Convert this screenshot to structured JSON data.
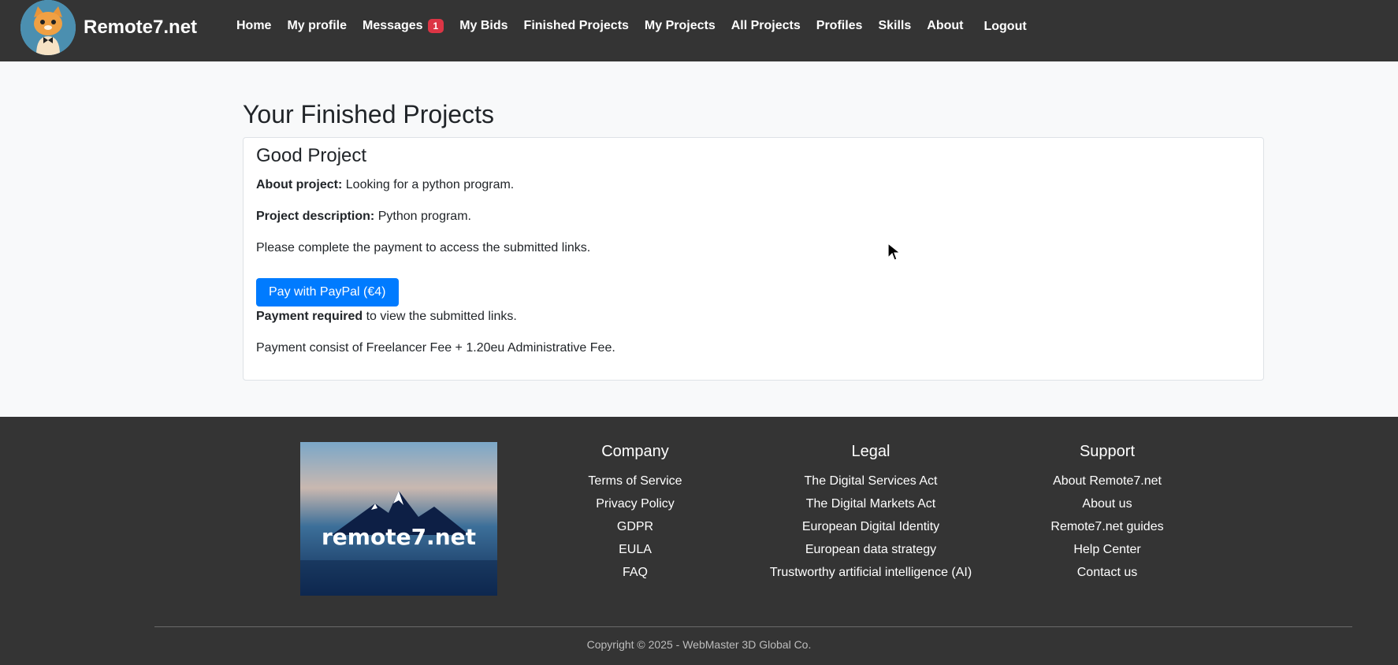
{
  "brand": {
    "name": "Remote7.net",
    "logo_icon": "cat-mascot-logo"
  },
  "nav": {
    "items": [
      "Home",
      "My profile",
      "Messages",
      "My Bids",
      "Finished Projects",
      "My Projects",
      "All Projects",
      "Profiles",
      "Skills",
      "About"
    ],
    "messages_badge": "1",
    "logout": "Logout"
  },
  "page": {
    "title": "Your Finished Projects"
  },
  "project": {
    "title": "Good Project",
    "about_label": "About project:",
    "about_value": " Looking for a python program.",
    "description_label": "Project description:",
    "description_value": " Python program.",
    "payment_notice": "Please complete the payment to access the submitted links.",
    "pay_button": "Pay with PayPal (€4)",
    "payment_required_label": "Payment required",
    "payment_required_text": " to view the submitted links.",
    "fee_note": "Payment consist of Freelancer Fee + 1.20eu Administrative Fee."
  },
  "footer": {
    "logo_text": "remote7.net",
    "company": {
      "title": "Company",
      "links": [
        "Terms of Service",
        "Privacy Policy",
        "GDPR",
        "EULA",
        "FAQ"
      ]
    },
    "legal": {
      "title": "Legal",
      "links": [
        "The Digital Services Act",
        "The Digital Markets Act",
        "European Digital Identity",
        "European data strategy",
        "Trustworthy artificial intelligence (AI)"
      ]
    },
    "support": {
      "title": "Support",
      "links": [
        "About Remote7.net",
        "About us",
        "Remote7.net guides",
        "Help Center",
        "Contact us"
      ]
    },
    "copyright": "Copyright © 2025 - WebMaster 3D Global Co."
  },
  "colors": {
    "navbar": "#343434",
    "primary": "#007bff",
    "badge": "#dc3545"
  }
}
